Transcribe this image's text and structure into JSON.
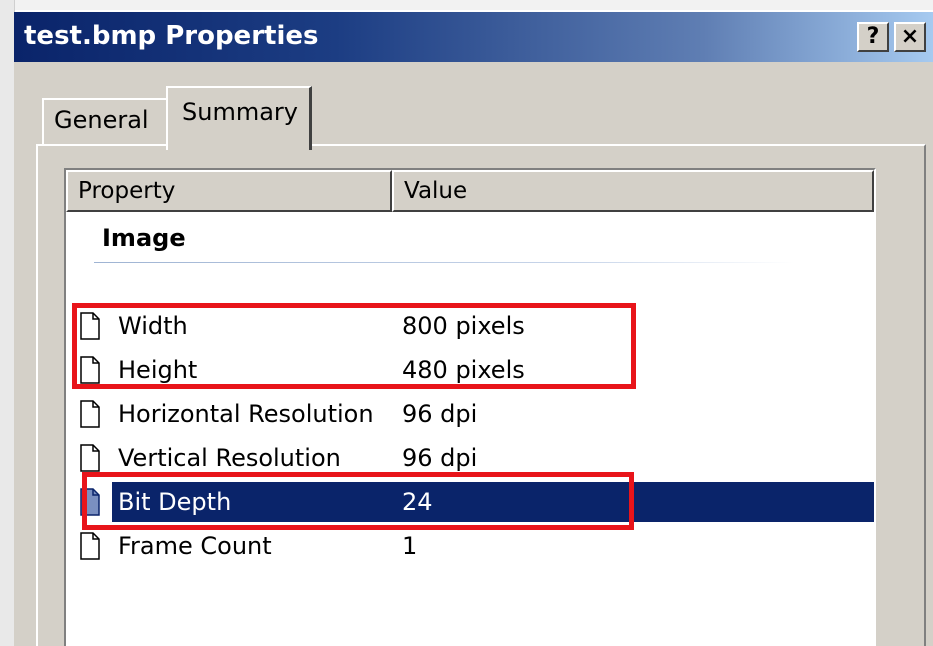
{
  "window": {
    "title": "test.bmp Properties",
    "help_label": "?",
    "close_label": "×"
  },
  "tabs": [
    {
      "label": "General",
      "active": false
    },
    {
      "label": "Summary",
      "active": true
    }
  ],
  "listview": {
    "columns": [
      "Property",
      "Value"
    ],
    "group": "Image",
    "rows": [
      {
        "property": "Width",
        "value": "800 pixels",
        "icon": "document-icon",
        "selected": false
      },
      {
        "property": "Height",
        "value": "480 pixels",
        "icon": "document-icon",
        "selected": false
      },
      {
        "property": "Horizontal Resolution",
        "value": "96 dpi",
        "icon": "document-icon",
        "selected": false
      },
      {
        "property": "Vertical Resolution",
        "value": "96 dpi",
        "icon": "document-icon",
        "selected": false
      },
      {
        "property": "Bit Depth",
        "value": "24",
        "icon": "document-icon",
        "selected": true
      },
      {
        "property": "Frame Count",
        "value": "1",
        "icon": "document-icon",
        "selected": false
      }
    ]
  },
  "colors": {
    "title_bar": "#0a246a",
    "selection": "#0a246a",
    "highlight_box": "#e8141a",
    "dialog_face": "#d4d0c8"
  }
}
